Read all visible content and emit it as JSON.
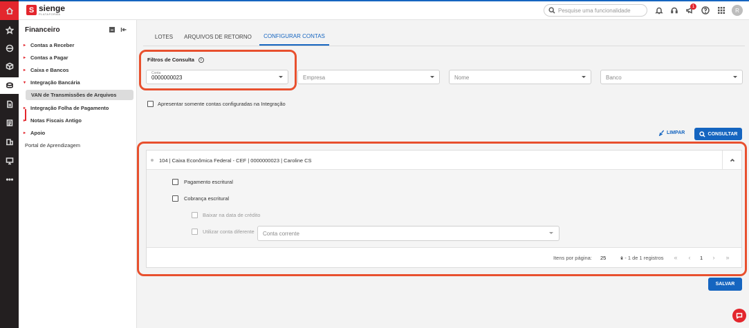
{
  "app": {
    "logo_text": "sienge",
    "logo_sub": "PLATAFORMA",
    "logo_mark": "S"
  },
  "header": {
    "search_placeholder": "Pesquise uma funcionalidade",
    "notification_count": "1",
    "avatar_initial": "R",
    "icons": [
      "bell-icon",
      "headset-icon",
      "megaphone-icon",
      "help-icon",
      "apps-grid-icon"
    ]
  },
  "rail": {
    "icons": [
      "home-icon",
      "star-icon",
      "globe-icon",
      "cube-icon",
      "money-icon",
      "document-icon",
      "list-icon",
      "building-icon",
      "monitor-icon",
      "more-icon"
    ]
  },
  "side": {
    "title": "Financeiro",
    "items": [
      {
        "label": "Contas a Receber"
      },
      {
        "label": "Contas a Pagar"
      },
      {
        "label": "Caixa e Bancos"
      },
      {
        "label": "Integração Bancária"
      },
      {
        "label": "VAN de Transmissões de Arquivos"
      },
      {
        "label": "Integração Folha de Pagamento"
      },
      {
        "label": "Notas Fiscais Antigo"
      },
      {
        "label": "Apoio"
      },
      {
        "label": "Portal de Aprendizagem"
      }
    ]
  },
  "tabs": [
    {
      "label": "LOTES"
    },
    {
      "label": "ARQUIVOS DE RETORNO"
    },
    {
      "label": "CONFIGURAR CONTAS"
    }
  ],
  "filters": {
    "title": "Filtros de Consulta",
    "info_icon": "i",
    "conta": {
      "label": "Conta",
      "value": "0000000023"
    },
    "empresa": {
      "placeholder": "Empresa"
    },
    "nome": {
      "placeholder": "Nome"
    },
    "banco": {
      "placeholder": "Banco"
    },
    "only_configured_label": "Apresentar somente contas configuradas na Integração"
  },
  "actions": {
    "clear_label": "LIMPAR",
    "consult_label": "CONSULTAR",
    "save_label": "SALVAR"
  },
  "account": {
    "title": "104 | Caixa Econômica Federal - CEF | 0000000023 | Caroline CS",
    "pagamento_label": "Pagamento escritural",
    "cobranca_label": "Cobrança escritural",
    "baixar_label": "Baixar na data de crédito",
    "utilizar_label": "Utilizar conta diferente",
    "conta_corrente_placeholder": "Conta corrente"
  },
  "pager": {
    "items_per_page_label": "Itens por página:",
    "items_per_page": "25",
    "range": "1 - 1 de 1 registros",
    "current_page": "1",
    "first_glyph": "«",
    "prev_glyph": "‹",
    "next_glyph": "›",
    "last_glyph": "»"
  },
  "colors": {
    "brand_red": "#e3262d",
    "primary_blue": "#1565c0",
    "highlight_orange": "#e8502e"
  }
}
